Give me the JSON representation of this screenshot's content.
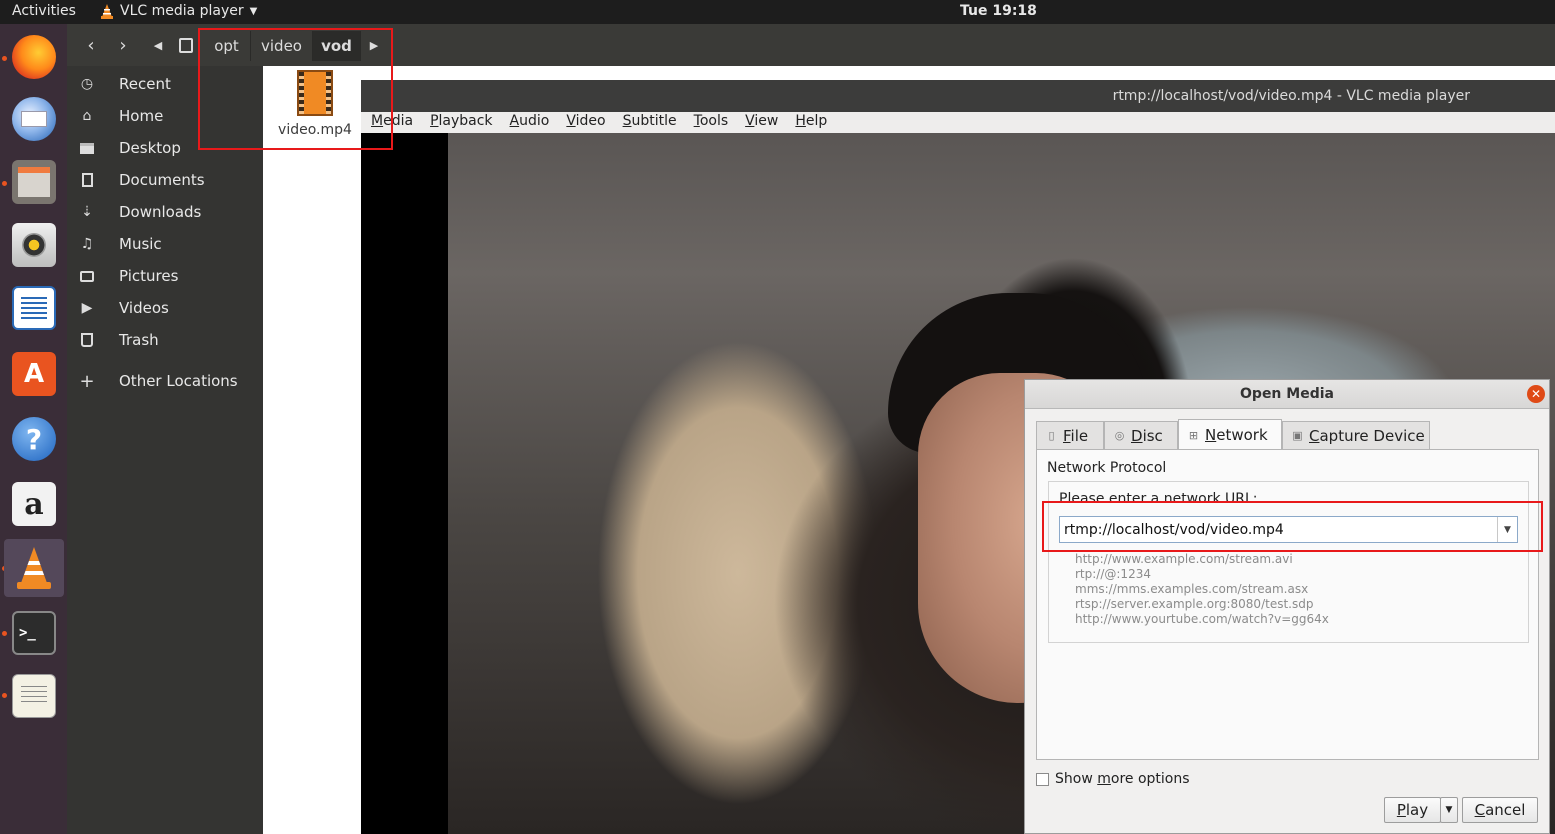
{
  "topbar": {
    "activities": "Activities",
    "app_name": "VLC media player",
    "clock": "Tue 19:18"
  },
  "dock": {
    "items": [
      "firefox",
      "thunderbird",
      "files",
      "rhythmbox",
      "libreoffice-writer",
      "ubuntu-software",
      "help",
      "amazon",
      "vlc",
      "terminal",
      "text-editor"
    ]
  },
  "files": {
    "breadcrumb": [
      "opt",
      "video",
      "vod"
    ],
    "sidebar": [
      {
        "icon": "clock-icon",
        "label": "Recent"
      },
      {
        "icon": "home-icon",
        "label": "Home"
      },
      {
        "icon": "folder-icon",
        "label": "Desktop"
      },
      {
        "icon": "document-icon",
        "label": "Documents"
      },
      {
        "icon": "download-icon",
        "label": "Downloads"
      },
      {
        "icon": "music-icon",
        "label": "Music"
      },
      {
        "icon": "camera-icon",
        "label": "Pictures"
      },
      {
        "icon": "video-icon",
        "label": "Videos"
      },
      {
        "icon": "trash-icon",
        "label": "Trash"
      },
      {
        "icon": "plus-icon",
        "label": "Other Locations"
      }
    ],
    "file_name": "video.mp4"
  },
  "vlc": {
    "title": "rtmp://localhost/vod/video.mp4 - VLC media player",
    "menu": [
      {
        "mnemonic": "M",
        "rest": "edia"
      },
      {
        "mnemonic": "P",
        "rest": "layback"
      },
      {
        "mnemonic": "A",
        "rest": "udio"
      },
      {
        "mnemonic": "V",
        "rest": "ideo"
      },
      {
        "mnemonic": "S",
        "rest": "ubtitle"
      },
      {
        "mnemonic": "T",
        "rest": "ools"
      },
      {
        "mnemonic": "V",
        "rest": "iew"
      },
      {
        "mnemonic": "H",
        "rest": "elp"
      }
    ]
  },
  "dialog": {
    "title": "Open Media",
    "tabs": [
      {
        "pre": "",
        "mn": "F",
        "post": "ile"
      },
      {
        "pre": "",
        "mn": "D",
        "post": "isc"
      },
      {
        "pre": "",
        "mn": "N",
        "post": "etwork"
      },
      {
        "pre": "",
        "mn": "C",
        "post": "apture Device"
      }
    ],
    "network_protocol": "Network Protocol",
    "url_label": "Please enter a network URL:",
    "url_value": "rtmp://localhost/vod/video.mp4",
    "examples": [
      "http://www.example.com/stream.avi",
      "rtp://@:1234",
      "mms://mms.examples.com/stream.asx",
      "rtsp://server.example.org:8080/test.sdp",
      "http://www.yourtube.com/watch?v=gg64x"
    ],
    "show_more_pre": "Show ",
    "show_more_mn": "m",
    "show_more_post": "ore options",
    "play_mn": "P",
    "play_rest": "lay",
    "cancel_mn": "C",
    "cancel_rest": "ancel"
  },
  "colors": {
    "ubuntu_orange": "#e95420",
    "highlight_red": "#e8191a",
    "dock_bg": "#3a2d38"
  }
}
